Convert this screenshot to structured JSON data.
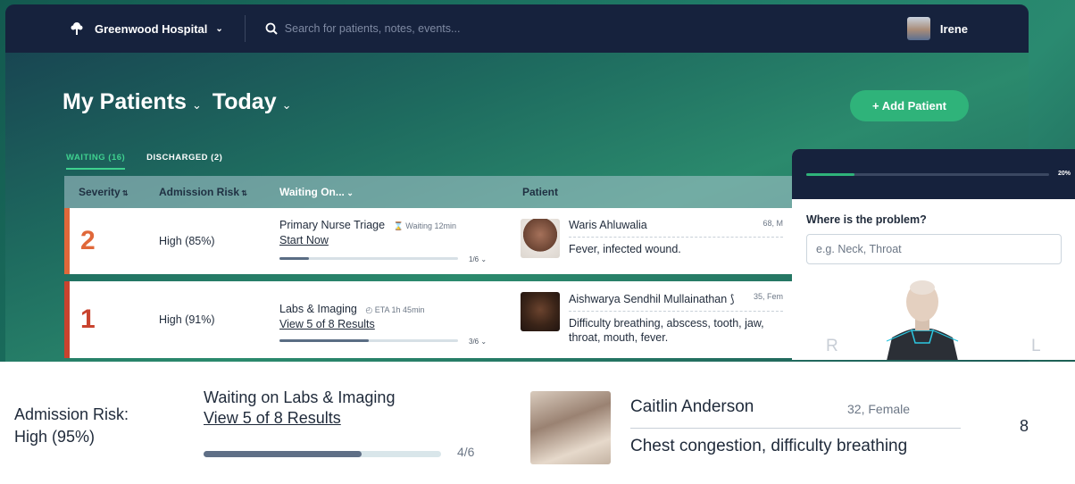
{
  "topbar": {
    "hospital": "Greenwood Hospital",
    "search_placeholder": "Search for patients, notes, events...",
    "user_name": "Irene"
  },
  "header": {
    "title": "My Patients",
    "filter": "Today",
    "add_button": "+ Add Patient"
  },
  "tabs": [
    {
      "label": "WAITING (16)",
      "active": true
    },
    {
      "label": "DISCHARGED (2)",
      "active": false
    }
  ],
  "table": {
    "columns": [
      "Severity",
      "Admission Risk",
      "Waiting On...",
      "Patient"
    ],
    "rows": [
      {
        "severity": "2",
        "risk": "High (85%)",
        "waiting": "Primary Nurse Triage",
        "waiting_meta": "Waiting 12min",
        "action": "Start Now",
        "progress_fraction": 0.167,
        "progress_text": "1/6",
        "patient_name": "Waris Ahluwalia",
        "patient_age": "68, M",
        "condition": "Fever, infected wound."
      },
      {
        "severity": "1",
        "risk": "High (91%)",
        "waiting": "Labs & Imaging",
        "waiting_meta": "ETA 1h 45min",
        "action": "View 5 of 8 Results",
        "progress_fraction": 0.5,
        "progress_text": "3/6",
        "patient_name": "Aishwarya Sendhil Mullainathan",
        "patient_age": "35, Fem",
        "condition": "Difficulty breathing, abscess, tooth, jaw, throat, mouth, fever."
      }
    ]
  },
  "side_panel": {
    "progress_text": "20%",
    "progress_fraction": 0.2,
    "question": "Where is the problem?",
    "input_placeholder": "e.g. Neck, Throat",
    "left_label": "R",
    "right_label": "L"
  },
  "detail": {
    "risk_label": "Admission Risk:",
    "risk_value": "High (95%)",
    "waiting": "Waiting on Labs & Imaging",
    "action": "View 5 of 8 Results",
    "progress_fraction": 0.667,
    "progress_text": "4/6",
    "patient_name": "Caitlin Anderson",
    "patient_age": "32, Female",
    "condition": "Chest congestion, difficulty breathing",
    "trailing_number": "8"
  },
  "colors": {
    "navbar": "#16223d",
    "accent_green": "#2fb37a",
    "severity_2": "#e0683a",
    "severity_1": "#c9432e"
  }
}
